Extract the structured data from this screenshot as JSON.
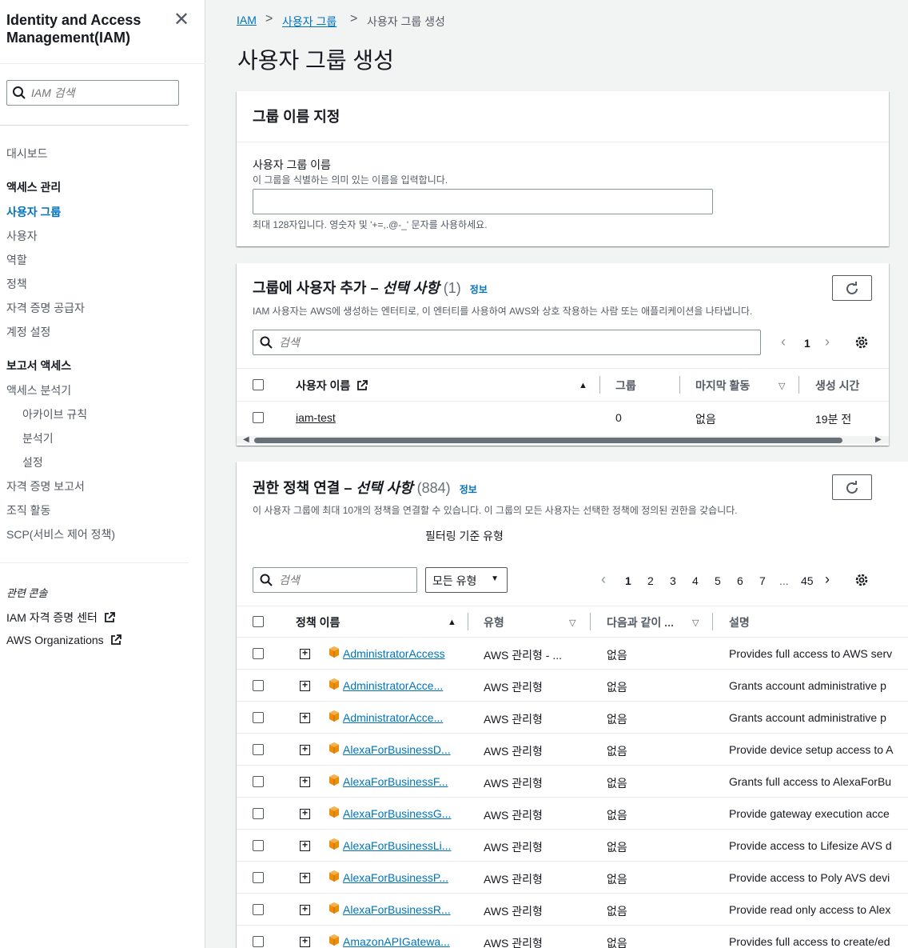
{
  "sidebar": {
    "title": "Identity and Access Management(IAM)",
    "search_placeholder": "IAM 검색",
    "dashboard": "대시보드",
    "access_mgmt_header": "액세스 관리",
    "items": [
      "사용자 그룹",
      "사용자",
      "역할",
      "정책",
      "자격 증명 공급자",
      "계정 설정"
    ],
    "reports_header": "보고서 액세스",
    "report_items": [
      "액세스 분석기"
    ],
    "report_sub_items": [
      "아카이브 규칙",
      "분석기",
      "설정"
    ],
    "report_items2": [
      "자격 증명 보고서",
      "조직 활동",
      "SCP(서비스 제어 정책)"
    ],
    "related_header": "관련 콘솔",
    "related": [
      "IAM 자격 증명 센터",
      "AWS Organizations"
    ]
  },
  "breadcrumb": [
    "IAM",
    "사용자 그룹",
    "사용자 그룹 생성"
  ],
  "page_title": "사용자 그룹 생성",
  "group_name_panel": {
    "header": "그룹 이름 지정",
    "label": "사용자 그룹 이름",
    "description": "이 그룹을 식별하는 의미 있는 이름을 입력합니다.",
    "value": "",
    "constraint": "최대 128자입니다. 영숫자 및 '+=,.@-_' 문자를 사용하세요."
  },
  "users_panel": {
    "header_main": "그룹에 사용자 추가 – ",
    "header_italic": "선택 사항",
    "count": "(1)",
    "info": "정보",
    "description": "IAM 사용자는 AWS에 생성하는 엔터티로, 이 엔터티를 사용하여 AWS와 상호 작용하는 사람 또는 애플리케이션을 나타냅니다.",
    "search_placeholder": "검색",
    "page": "1",
    "columns": [
      "사용자 이름",
      "그룹",
      "마지막 활동",
      "생성 시간"
    ],
    "rows": [
      {
        "name": "iam-test",
        "groups": "0",
        "last_activity": "없음",
        "created": "19분 전"
      }
    ]
  },
  "policies_panel": {
    "header_main": "권한 정책 연결 – ",
    "header_italic": "선택 사항",
    "count": "(884)",
    "info": "정보",
    "description": "이 사용자 그룹에 최대 10개의 정책을 연결할 수 있습니다. 이 그룹의 모든 사용자는 선택한 정책에 정의된 권한을 갖습니다.",
    "filter_label": "필터링 기준 유형",
    "search_placeholder": "검색",
    "filter_value": "모든 유형",
    "pages": [
      "1",
      "2",
      "3",
      "4",
      "5",
      "6",
      "7",
      "...",
      "45"
    ],
    "columns": [
      "정책 이름",
      "유형",
      "다음과 같이 ...",
      "설명"
    ],
    "rows": [
      {
        "name": "AdministratorAccess",
        "type": "AWS 관리형 - ...",
        "used_as": "없음",
        "desc": "Provides full access to AWS serv"
      },
      {
        "name": "AdministratorAcce...",
        "type": "AWS 관리형",
        "used_as": "없음",
        "desc": "Grants account administrative p"
      },
      {
        "name": "AdministratorAcce...",
        "type": "AWS 관리형",
        "used_as": "없음",
        "desc": "Grants account administrative p"
      },
      {
        "name": "AlexaForBusinessD...",
        "type": "AWS 관리형",
        "used_as": "없음",
        "desc": "Provide device setup access to A"
      },
      {
        "name": "AlexaForBusinessF...",
        "type": "AWS 관리형",
        "used_as": "없음",
        "desc": "Grants full access to AlexaForBu"
      },
      {
        "name": "AlexaForBusinessG...",
        "type": "AWS 관리형",
        "used_as": "없음",
        "desc": "Provide gateway execution acce"
      },
      {
        "name": "AlexaForBusinessLi...",
        "type": "AWS 관리형",
        "used_as": "없음",
        "desc": "Provide access to Lifesize AVS d"
      },
      {
        "name": "AlexaForBusinessP...",
        "type": "AWS 관리형",
        "used_as": "없음",
        "desc": "Provide access to Poly AVS devi"
      },
      {
        "name": "AlexaForBusinessR...",
        "type": "AWS 관리형",
        "used_as": "없음",
        "desc": "Provide read only access to Alex"
      },
      {
        "name": "AmazonAPIGatewa...",
        "type": "AWS 관리형",
        "used_as": "없음",
        "desc": "Provides full access to create/ed"
      }
    ]
  },
  "colors": {
    "link": "#0073bb",
    "cube": "#ec8d0c",
    "background": "#f2f3f3"
  },
  "icons": [
    "close-icon",
    "search-icon",
    "external-link-icon",
    "refresh-icon",
    "gear-icon",
    "expand-icon",
    "policy-cube-icon",
    "chevron-left-icon",
    "chevron-right-icon",
    "sort-ascending-icon",
    "sort-descending-icon"
  ]
}
